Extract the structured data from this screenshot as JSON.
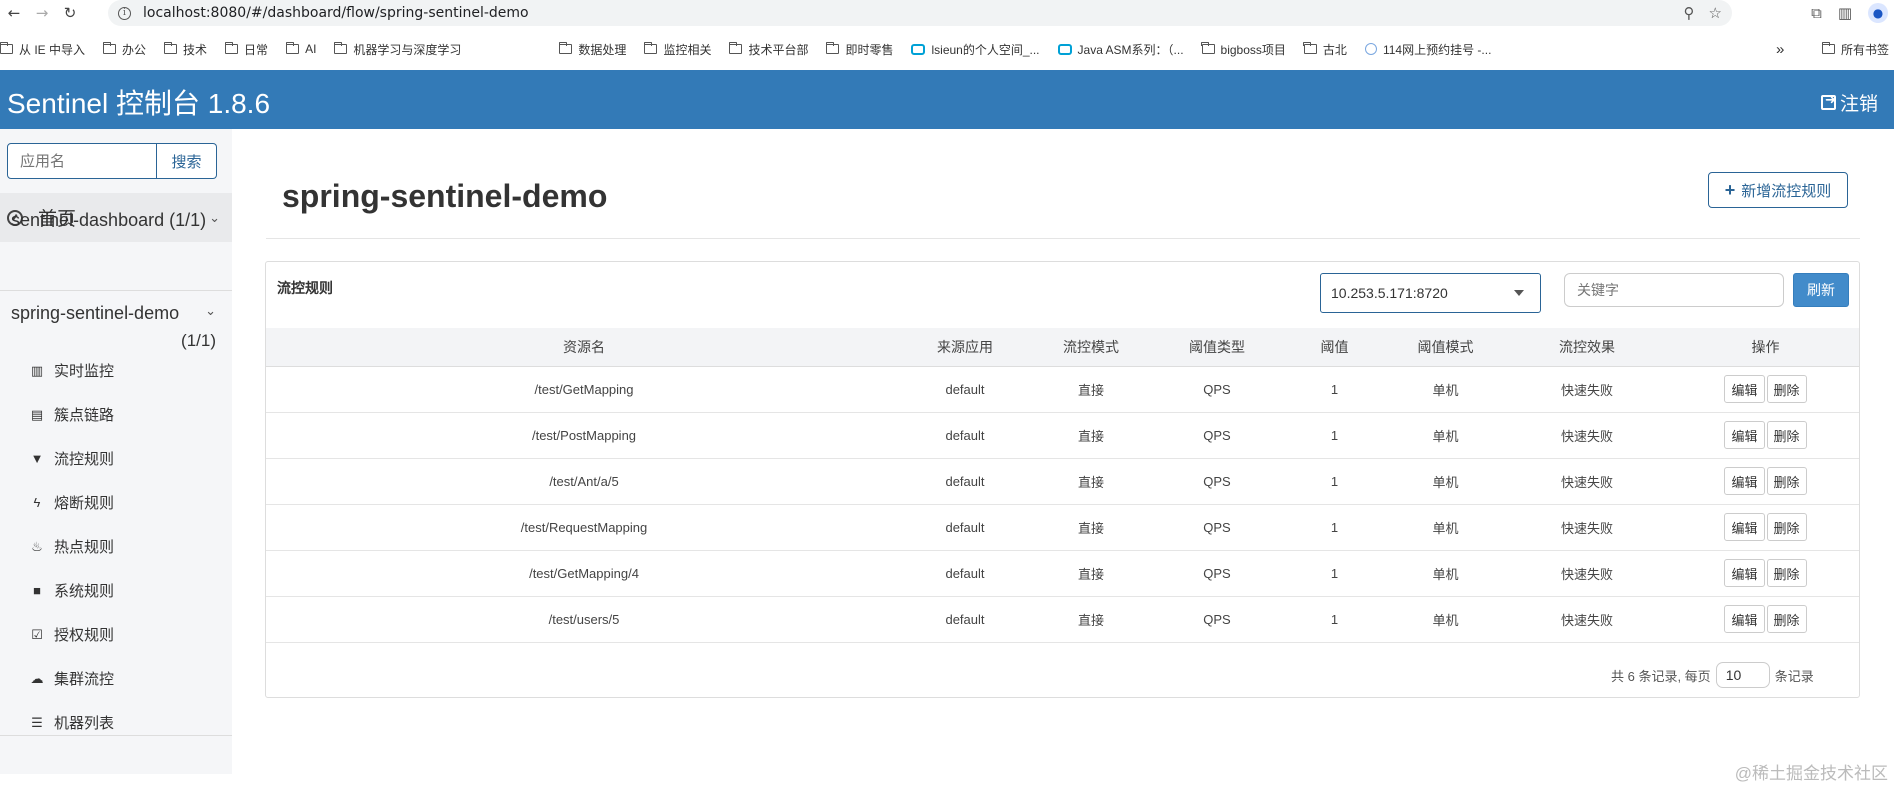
{
  "browser": {
    "url": "localhost:8080/#/dashboard/flow/spring-sentinel-demo",
    "bookmarks": [
      "从 IE 中导入",
      "办公",
      "技术",
      "日常",
      "AI",
      "机器学习与深度学习",
      "数据处理",
      "监控相关",
      "技术平台部",
      "即时零售",
      "lsieun的个人空间_...",
      "Java ASM系列：（...",
      "bigboss项目",
      "古北",
      "114网上预约挂号 -..."
    ],
    "more": "»",
    "all_bookmarks": "所有书签"
  },
  "header": {
    "title": "Sentinel 控制台 1.8.6",
    "logout_label": "注销"
  },
  "sidebar": {
    "search_placeholder": "应用名",
    "search_button": "搜索",
    "home_label": "首页",
    "apps": [
      {
        "name": "sentinel-dashboard",
        "count": "(1/1)"
      },
      {
        "name": "spring-sentinel-demo",
        "count": "(1/1)"
      }
    ],
    "menu": [
      {
        "label": "实时监控",
        "icon": "bar-chart-icon"
      },
      {
        "label": "簇点链路",
        "icon": "list-alt-icon"
      },
      {
        "label": "流控规则",
        "icon": "filter-icon"
      },
      {
        "label": "熔断规则",
        "icon": "flash-icon"
      },
      {
        "label": "热点规则",
        "icon": "fire-icon"
      },
      {
        "label": "系统规则",
        "icon": "lock-icon"
      },
      {
        "label": "授权规则",
        "icon": "check-icon"
      },
      {
        "label": "集群流控",
        "icon": "cloud-icon"
      },
      {
        "label": "机器列表",
        "icon": "th-list-icon"
      }
    ]
  },
  "main": {
    "page_title": "spring-sentinel-demo",
    "add_button": "新增流控规则",
    "panel_title": "流控规则",
    "machine": "10.253.5.171:8720",
    "keyword_placeholder": "关键字",
    "refresh_button": "刷新",
    "columns": [
      "资源名",
      "来源应用",
      "流控模式",
      "阈值类型",
      "阈值",
      "阈值模式",
      "流控效果",
      "操作"
    ],
    "rows": [
      [
        "/test/GetMapping",
        "default",
        "直接",
        "QPS",
        "1",
        "单机",
        "快速失败"
      ],
      [
        "/test/PostMapping",
        "default",
        "直接",
        "QPS",
        "1",
        "单机",
        "快速失败"
      ],
      [
        "/test/Ant/a/5",
        "default",
        "直接",
        "QPS",
        "1",
        "单机",
        "快速失败"
      ],
      [
        "/test/RequestMapping",
        "default",
        "直接",
        "QPS",
        "1",
        "单机",
        "快速失败"
      ],
      [
        "/test/GetMapping/4",
        "default",
        "直接",
        "QPS",
        "1",
        "单机",
        "快速失败"
      ],
      [
        "/test/users/5",
        "default",
        "直接",
        "QPS",
        "1",
        "单机",
        "快速失败"
      ]
    ],
    "edit_label": "编辑",
    "delete_label": "删除",
    "pager_prefix": "共 6 条记录, 每页",
    "page_size": "10",
    "pager_suffix": "条记录"
  },
  "watermark": "@稀土掘金技术社区"
}
